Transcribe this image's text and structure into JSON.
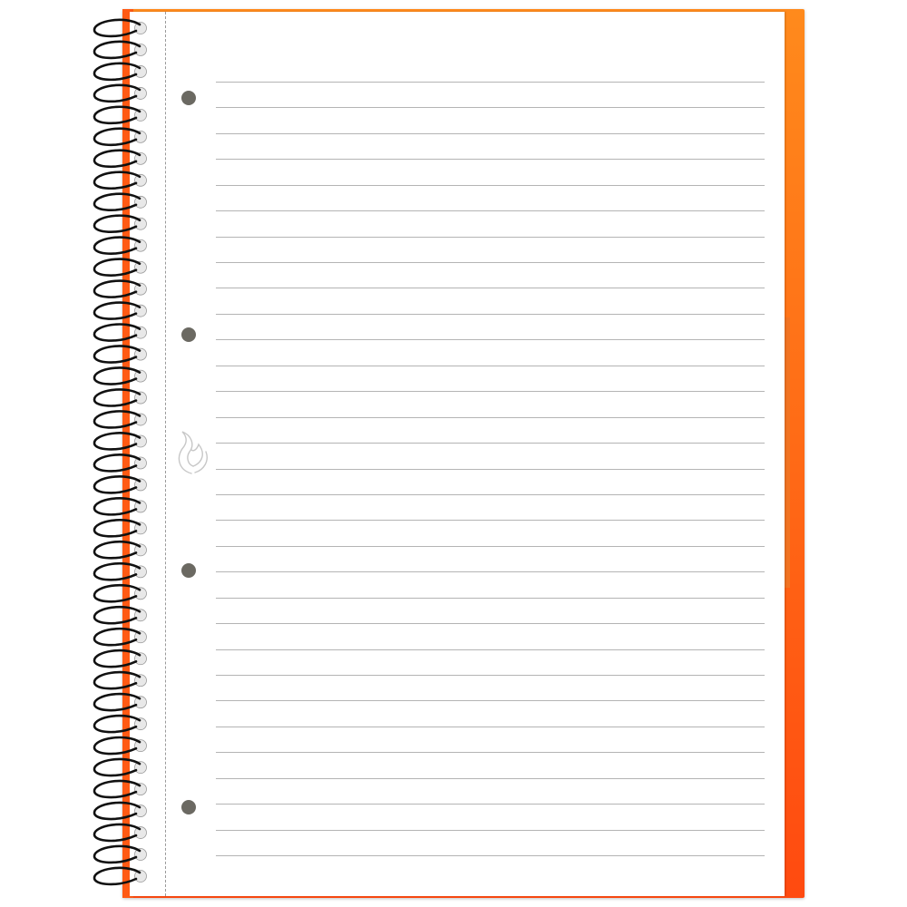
{
  "notebook": {
    "colors": {
      "cover_light": "#ff8a1c",
      "cover_dark": "#ff4a10",
      "cover_edge": "#ff5a14",
      "tab": "#f27322",
      "page": "#ffffff",
      "rule": "#b4b4b4",
      "punch_hole": "#6b6962",
      "wire": "#111111",
      "spiral_hole": "#e8e8e8",
      "margin_perforation": "#9a9a9a",
      "logo_stroke": "#c7c7c7"
    },
    "ruled_line_count": 31,
    "punch_hole_count": 4,
    "spiral_loop_count": 40,
    "icons": {
      "logo": "flame-logo-icon",
      "binding": "spiral-binding-icon"
    }
  }
}
